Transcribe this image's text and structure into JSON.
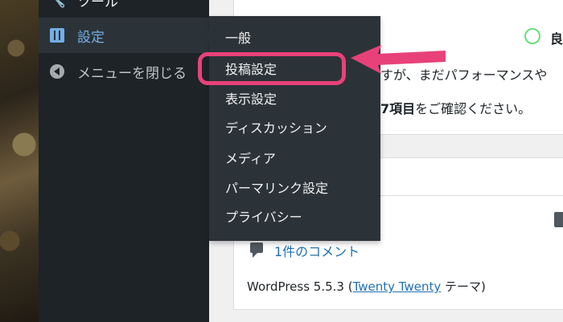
{
  "sidebar": {
    "tools_label": "ツール",
    "settings_label": "設定",
    "collapse_label": "メニューを閉じる"
  },
  "submenu": {
    "items": [
      {
        "label": "一般"
      },
      {
        "label": "投稿設定"
      },
      {
        "label": "表示設定"
      },
      {
        "label": "ディスカッション"
      },
      {
        "label": "メディア"
      },
      {
        "label": "パーマリンク設定"
      },
      {
        "label": "プライバシー"
      }
    ],
    "highlighted_index": 1
  },
  "site_health": {
    "status_label": "良",
    "message_line1": "すが、まだパフォーマンスや",
    "message_count": "7項目",
    "message_line2_suffix": "をご確認ください。"
  },
  "at_a_glance": {
    "comments_link": "1件のコメント",
    "version_prefix": "WordPress 5.5.3 (",
    "theme_name": "Twenty Twenty",
    "version_suffix": " テーマ)"
  },
  "colors": {
    "sidebar_bg": "#1d2327",
    "submenu_bg": "#2c3338",
    "accent": "#72aee6",
    "highlight": "#e8417a",
    "link": "#2271b1"
  }
}
